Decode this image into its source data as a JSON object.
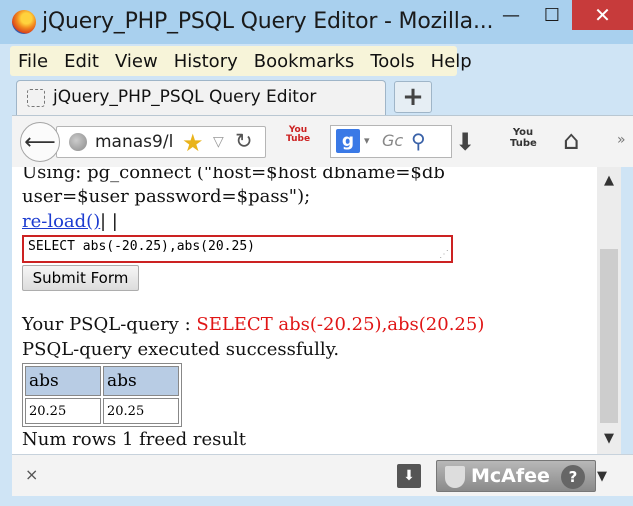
{
  "window": {
    "title": "jQuery_PHP_PSQL Query Editor - Mozilla...",
    "minimize": "—",
    "maximize": "☐",
    "close": "✕",
    "icon": "firefox-logo"
  },
  "menu": {
    "items": [
      "File",
      "Edit",
      "View",
      "History",
      "Bookmarks",
      "Tools",
      "Help"
    ]
  },
  "tabs": [
    {
      "label": "jQuery_PHP_PSQL Query Editor",
      "active": true
    }
  ],
  "new_tab_label": "+",
  "nav": {
    "back": "⟵",
    "url": "manas9/l",
    "star": "★",
    "dropdown": "▽",
    "reload": "↻",
    "youtube1": "You Tube",
    "search_engine": "g",
    "search_dropdown": "▾",
    "search_placeholder": "Gc",
    "search_icon": "⚲",
    "download": "⬇",
    "youtube2": "You Tube",
    "home": "⌂",
    "more": "»"
  },
  "content": {
    "connect_text": "Using: pg_connect (\"host=$host dbname=$db user=$user password=$pass\");",
    "reload_link": "re-load()",
    "pipes": "| |",
    "query_value": "SELECT abs(-20.25),abs(20.25)",
    "resize_handle": "⋰",
    "submit_label": "Submit Form",
    "your_query_label": "Your PSQL-query : ",
    "your_query_value": "SELECT abs(-20.25),abs(20.25)",
    "executed_message": "PSQL-query executed successfully.",
    "table": {
      "headers": [
        "abs",
        "abs"
      ],
      "rows": [
        [
          "20.25",
          "20.25"
        ]
      ]
    },
    "num_rows_text": "Num rows 1 freed result"
  },
  "scrollbar": {
    "up": "▲",
    "down": "▼"
  },
  "addon_bar": {
    "close": "×",
    "download": "⬇",
    "mcafee_label": "McAfee",
    "mcafee_help": "?",
    "dropdown": "▼"
  }
}
